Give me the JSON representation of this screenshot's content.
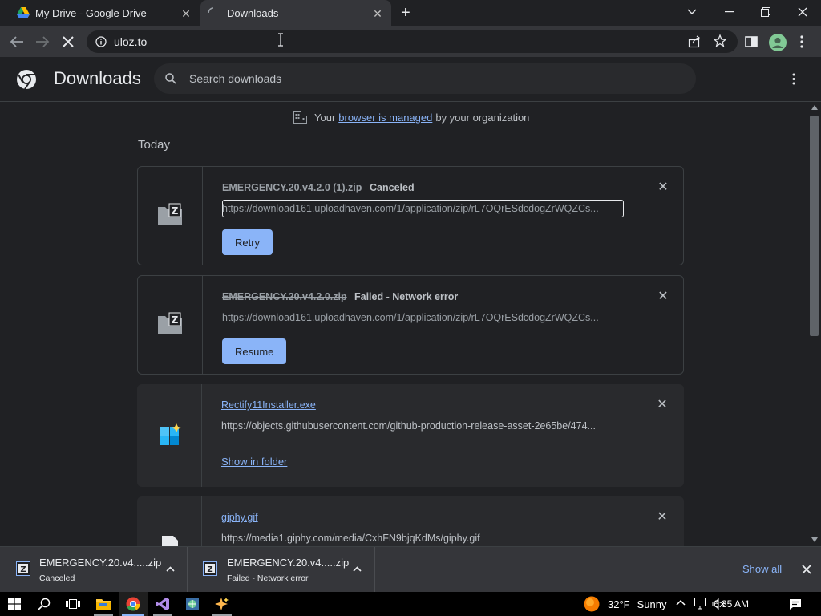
{
  "tabs": [
    {
      "title": "My Drive - Google Drive",
      "close": "✕"
    },
    {
      "title": "Downloads",
      "close": "✕"
    }
  ],
  "new_tab": "+",
  "window": {
    "minimize": "—",
    "maximize": "❐",
    "close": "✕",
    "tab_search": "⌄"
  },
  "toolbar": {
    "url": "uloz.to"
  },
  "downloads": {
    "title": "Downloads",
    "search_placeholder": "Search downloads",
    "managed_prefix": "Your",
    "managed_link": "browser is managed",
    "managed_suffix": "by your organization",
    "section": "Today",
    "items": [
      {
        "name": "EMERGENCY.20.v4.2.0 (1).zip",
        "status": "Canceled",
        "url": "https://download161.uploadhaven.com/1/application/zip/rL7OQrESdcdogZrWQZCs...",
        "action": "Retry"
      },
      {
        "name": "EMERGENCY.20.v4.2.0.zip",
        "status": "Failed - Network error",
        "url": "https://download161.uploadhaven.com/1/application/zip/rL7OQrESdcdogZrWQZCs...",
        "action": "Resume"
      },
      {
        "name": "Rectify11Installer.exe",
        "status": "",
        "url": "https://objects.githubusercontent.com/github-production-release-asset-2e65be/474...",
        "action": "Show in folder"
      },
      {
        "name": "giphy.gif",
        "status": "",
        "url": "https://media1.giphy.com/media/CxhFN9bjqKdMs/giphy.gif",
        "action": ""
      }
    ]
  },
  "shelf": {
    "items": [
      {
        "name": "EMERGENCY.20.v4.....zip",
        "status": "Canceled"
      },
      {
        "name": "EMERGENCY.20.v4.....zip",
        "status": "Failed - Network error"
      }
    ],
    "show_all": "Show all"
  },
  "taskbar": {
    "temperature": "32°F",
    "condition": "Sunny",
    "time": "6:35 AM"
  },
  "colors": {
    "accent": "#8ab4f8",
    "background": "#202124",
    "toolbar": "#35363a"
  }
}
